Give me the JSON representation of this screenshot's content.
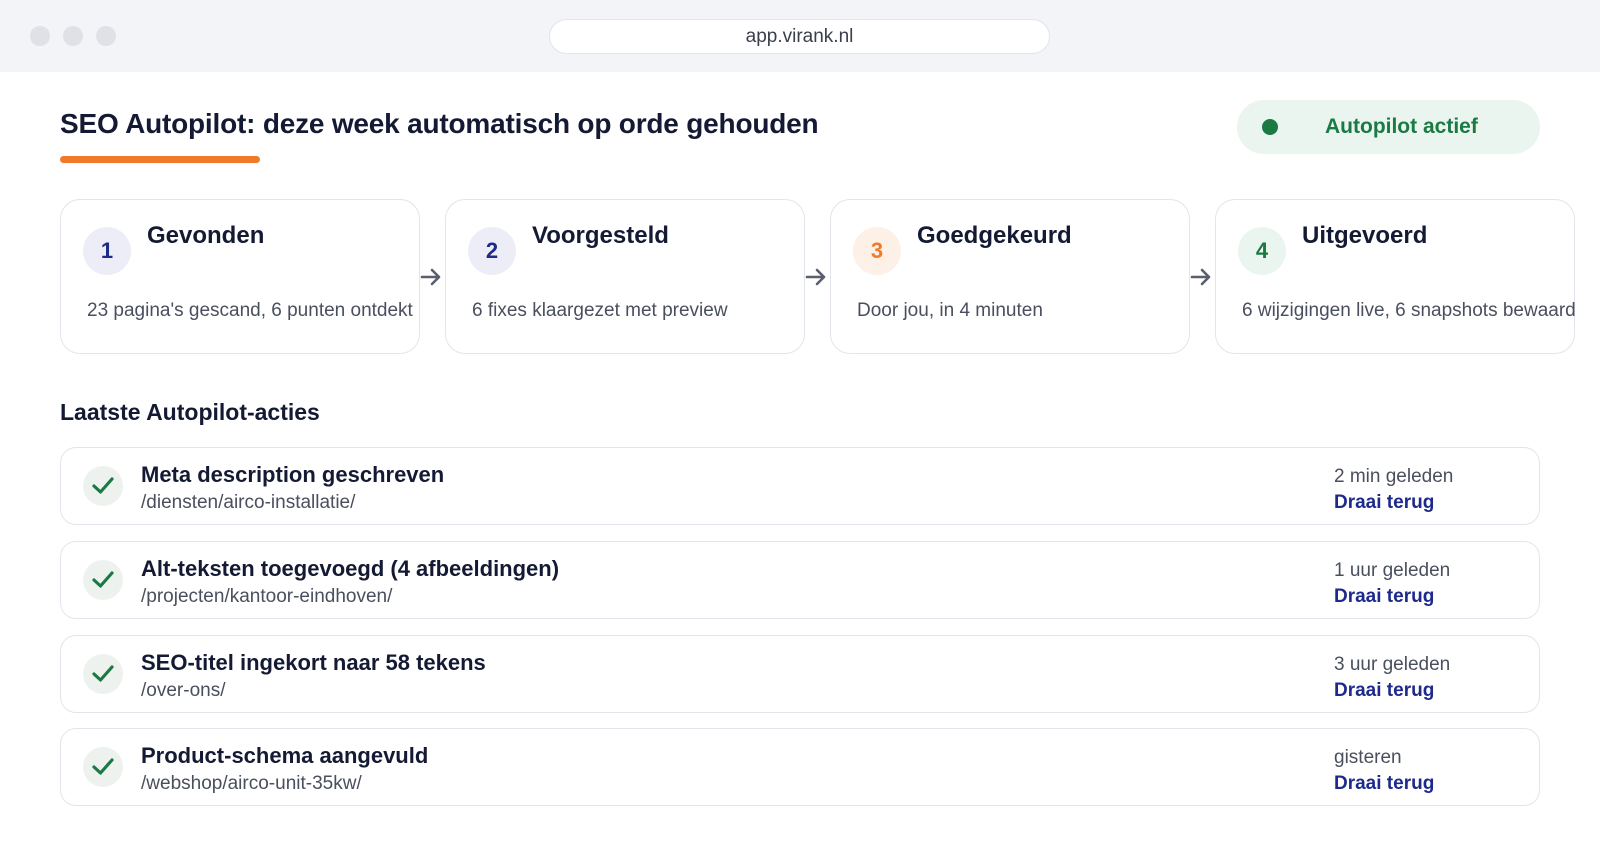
{
  "browser": {
    "url": "app.virank.nl"
  },
  "header": {
    "title": "SEO Autopilot: deze week automatisch op orde gehouden",
    "status_label": "Autopilot actief"
  },
  "steps": [
    {
      "number": "1",
      "title": "Gevonden",
      "description": "23 pagina's gescand, 6 punten ontdekt"
    },
    {
      "number": "2",
      "title": "Voorgesteld",
      "description": "6 fixes klaargezet met preview"
    },
    {
      "number": "3",
      "title": "Goedgekeurd",
      "description": "Door jou, in 4 minuten"
    },
    {
      "number": "4",
      "title": "Uitgevoerd",
      "description": "6 wijzigingen live, 6 snapshots bewaard"
    }
  ],
  "actions_section": {
    "title": "Laatste Autopilot-acties",
    "items": [
      {
        "title": "Meta description geschreven",
        "path": "/diensten/airco-installatie/",
        "time": "2 min geleden",
        "undo_label": "Draai terug"
      },
      {
        "title": "Alt-teksten toegevoegd (4 afbeeldingen)",
        "path": "/projecten/kantoor-eindhoven/",
        "time": "1 uur geleden",
        "undo_label": "Draai terug"
      },
      {
        "title": "SEO-titel ingekort naar 58 tekens",
        "path": "/over-ons/",
        "time": "3 uur geleden",
        "undo_label": "Draai terug"
      },
      {
        "title": "Product-schema aangevuld",
        "path": "/webshop/airco-unit-35kw/",
        "time": "gisteren",
        "undo_label": "Draai terug"
      }
    ]
  },
  "colors": {
    "accent_orange": "#f07a2a",
    "status_green": "#1b7a44",
    "link_navy": "#1d2a8c",
    "step1": "#1d2a8c",
    "step2": "#1d2a8c",
    "step3": "#f07a2a",
    "step4": "#1b7a44"
  },
  "icons": {
    "step_connector": "arrow-right-icon",
    "action_status": "check-icon"
  }
}
